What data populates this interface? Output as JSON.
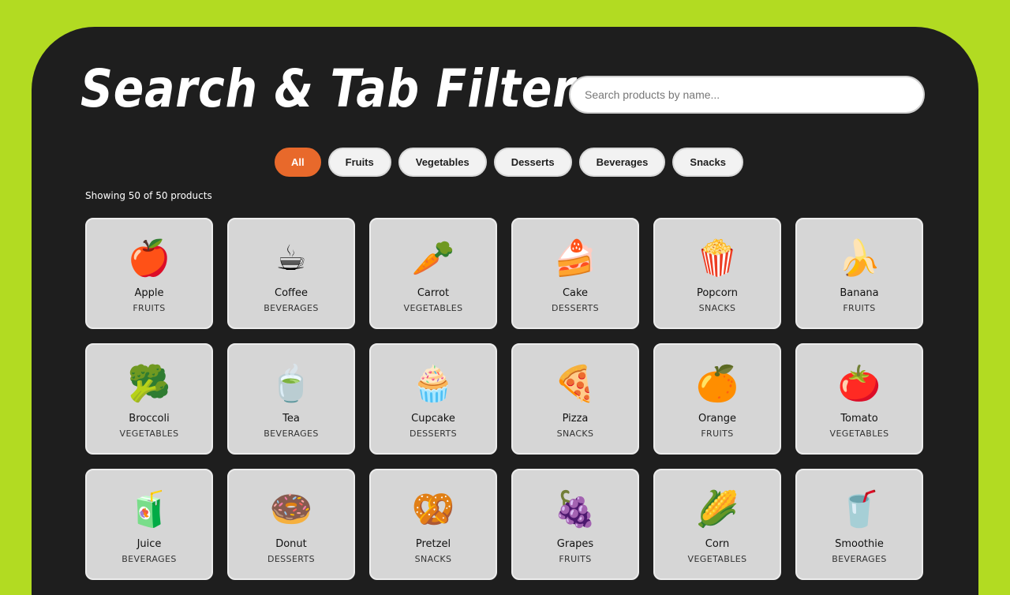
{
  "header": {
    "title": "Search & Tab Filter"
  },
  "search": {
    "placeholder": "Search products by name...",
    "value": ""
  },
  "tabs": [
    {
      "label": "All",
      "active": true
    },
    {
      "label": "Fruits",
      "active": false
    },
    {
      "label": "Vegetables",
      "active": false
    },
    {
      "label": "Desserts",
      "active": false
    },
    {
      "label": "Beverages",
      "active": false
    },
    {
      "label": "Snacks",
      "active": false
    }
  ],
  "results": {
    "summary": "Showing 50 of 50 products"
  },
  "products": [
    {
      "name": "Apple",
      "category": "FRUITS",
      "icon": "🍎",
      "icon_name": "apple-icon"
    },
    {
      "name": "Coffee",
      "category": "BEVERAGES",
      "icon": "☕",
      "icon_name": "coffee-icon"
    },
    {
      "name": "Carrot",
      "category": "VEGETABLES",
      "icon": "🥕",
      "icon_name": "carrot-icon"
    },
    {
      "name": "Cake",
      "category": "DESSERTS",
      "icon": "🍰",
      "icon_name": "cake-icon"
    },
    {
      "name": "Popcorn",
      "category": "SNACKS",
      "icon": "🍿",
      "icon_name": "popcorn-icon"
    },
    {
      "name": "Banana",
      "category": "FRUITS",
      "icon": "🍌",
      "icon_name": "banana-icon"
    },
    {
      "name": "Broccoli",
      "category": "VEGETABLES",
      "icon": "🥦",
      "icon_name": "broccoli-icon"
    },
    {
      "name": "Tea",
      "category": "BEVERAGES",
      "icon": "🍵",
      "icon_name": "tea-icon"
    },
    {
      "name": "Cupcake",
      "category": "DESSERTS",
      "icon": "🧁",
      "icon_name": "cupcake-icon"
    },
    {
      "name": "Pizza",
      "category": "SNACKS",
      "icon": "🍕",
      "icon_name": "pizza-icon"
    },
    {
      "name": "Orange",
      "category": "FRUITS",
      "icon": "🍊",
      "icon_name": "orange-icon"
    },
    {
      "name": "Tomato",
      "category": "VEGETABLES",
      "icon": "🍅",
      "icon_name": "tomato-icon"
    },
    {
      "name": "Juice",
      "category": "BEVERAGES",
      "icon": "🧃",
      "icon_name": "juice-box-icon"
    },
    {
      "name": "Donut",
      "category": "DESSERTS",
      "icon": "🍩",
      "icon_name": "donut-icon"
    },
    {
      "name": "Pretzel",
      "category": "SNACKS",
      "icon": "🥨",
      "icon_name": "pretzel-icon"
    },
    {
      "name": "Grapes",
      "category": "FRUITS",
      "icon": "🍇",
      "icon_name": "grapes-icon"
    },
    {
      "name": "Corn",
      "category": "VEGETABLES",
      "icon": "🌽",
      "icon_name": "corn-icon"
    },
    {
      "name": "Smoothie",
      "category": "BEVERAGES",
      "icon": "🥤",
      "icon_name": "smoothie-cup-icon"
    }
  ],
  "colors": {
    "page_background": "#b2db22",
    "panel_background": "#1e1e1e",
    "active_tab": "#e8692b",
    "card_background": "#d6d6d6"
  }
}
